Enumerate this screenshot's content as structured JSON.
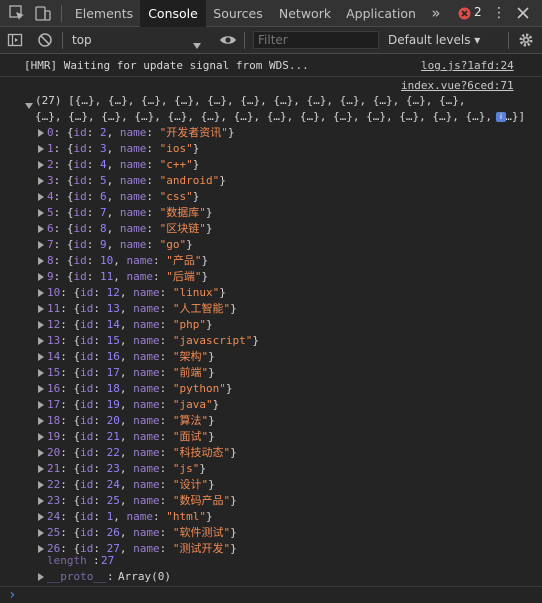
{
  "tabs": {
    "elements": "Elements",
    "console": "Console",
    "sources": "Sources",
    "network": "Network",
    "application": "Application",
    "more": "»"
  },
  "badges": {
    "errors": "2"
  },
  "toolbar": {
    "context": "top",
    "filter_placeholder": "Filter",
    "levels": "Default levels ▾"
  },
  "hmr": {
    "text": "[HMR] Waiting for update signal from WDS...",
    "source": "log.js?1afd:24"
  },
  "log_source": "index.vue?6ced:71",
  "array_summary": {
    "line1": "(27) [{…}, {…}, {…}, {…}, {…}, {…}, {…}, {…}, {…}, {…}, {…}, {…},",
    "line2": "{…}, {…}, {…}, {…}, {…}, {…}, {…}, {…}, {…}, {…}, {…}, {…}, {…}, {…}, {…}]"
  },
  "items": [
    {
      "index": "0",
      "id": "2",
      "name": "\"开发者资讯\""
    },
    {
      "index": "1",
      "id": "3",
      "name": "\"ios\""
    },
    {
      "index": "2",
      "id": "4",
      "name": "\"c++\""
    },
    {
      "index": "3",
      "id": "5",
      "name": "\"android\""
    },
    {
      "index": "4",
      "id": "6",
      "name": "\"css\""
    },
    {
      "index": "5",
      "id": "7",
      "name": "\"数据库\""
    },
    {
      "index": "6",
      "id": "8",
      "name": "\"区块链\""
    },
    {
      "index": "7",
      "id": "9",
      "name": "\"go\""
    },
    {
      "index": "8",
      "id": "10",
      "name": "\"产品\""
    },
    {
      "index": "9",
      "id": "11",
      "name": "\"后端\""
    },
    {
      "index": "10",
      "id": "12",
      "name": "\"linux\""
    },
    {
      "index": "11",
      "id": "13",
      "name": "\"人工智能\""
    },
    {
      "index": "12",
      "id": "14",
      "name": "\"php\""
    },
    {
      "index": "13",
      "id": "15",
      "name": "\"javascript\""
    },
    {
      "index": "14",
      "id": "16",
      "name": "\"架构\""
    },
    {
      "index": "15",
      "id": "17",
      "name": "\"前端\""
    },
    {
      "index": "16",
      "id": "18",
      "name": "\"python\""
    },
    {
      "index": "17",
      "id": "19",
      "name": "\"java\""
    },
    {
      "index": "18",
      "id": "20",
      "name": "\"算法\""
    },
    {
      "index": "19",
      "id": "21",
      "name": "\"面试\""
    },
    {
      "index": "20",
      "id": "22",
      "name": "\"科技动态\""
    },
    {
      "index": "21",
      "id": "23",
      "name": "\"js\""
    },
    {
      "index": "22",
      "id": "24",
      "name": "\"设计\""
    },
    {
      "index": "23",
      "id": "25",
      "name": "\"数码产品\""
    },
    {
      "index": "24",
      "id": "1",
      "name": "\"html\""
    },
    {
      "index": "25",
      "id": "26",
      "name": "\"软件测试\""
    },
    {
      "index": "26",
      "id": "27",
      "name": "\"测试开发\""
    }
  ],
  "length": {
    "label": "length",
    "value": "27"
  },
  "proto": {
    "label": "__proto__",
    "value": "Array(0)"
  },
  "prompt": "›"
}
